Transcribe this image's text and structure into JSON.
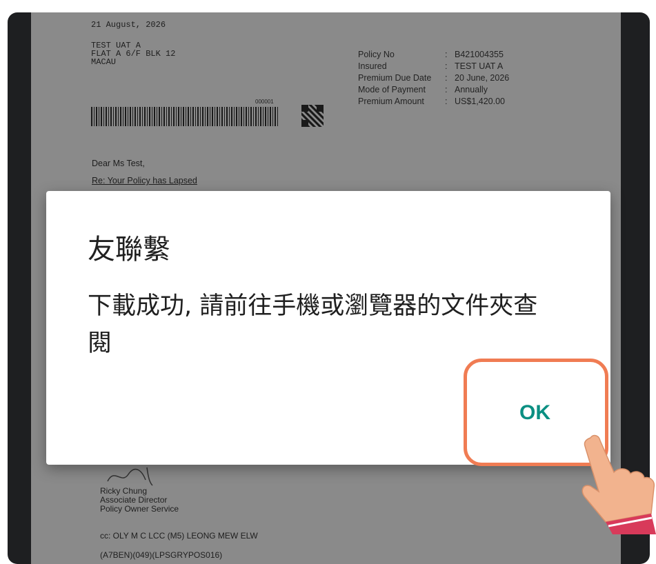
{
  "document": {
    "date": "21 August, 2026",
    "address": [
      "TEST UAT A",
      "FLAT A 6/F BLK 12",
      "MACAU"
    ],
    "barcode_number": "000001",
    "policy_details": [
      {
        "label": "Policy No",
        "value": "B421004355"
      },
      {
        "label": "Insured",
        "value": "TEST UAT A"
      },
      {
        "label": "Premium Due Date",
        "value": "20 June, 2026"
      },
      {
        "label": "Mode of Payment",
        "value": "Annually"
      },
      {
        "label": "Premium Amount",
        "value": "US$1,420.00"
      }
    ],
    "separator": ":",
    "salutation": "Dear Ms Test,",
    "subject": "Re: Your Policy has Lapsed",
    "signatory": {
      "name": "Ricky Chung",
      "title": "Associate Director",
      "department": "Policy Owner Service"
    },
    "cc_line": "cc: OLY M C LCC (M5) LEONG MEW ELW",
    "ref_line": "(A7BEN)(049)(LPSGRYPOS016)"
  },
  "dialog": {
    "title": "友聯繫",
    "message": "下載成功, 請前往手機或瀏覽器的文件夾查閱",
    "ok_label": "OK"
  },
  "colors": {
    "accent": "#0a8f82",
    "highlight": "#f07c53",
    "document_bg": "#8a8a8a",
    "frame": "#1e1f21"
  },
  "icons": [
    "barcode",
    "qr-code",
    "pointing-hand-icon"
  ]
}
